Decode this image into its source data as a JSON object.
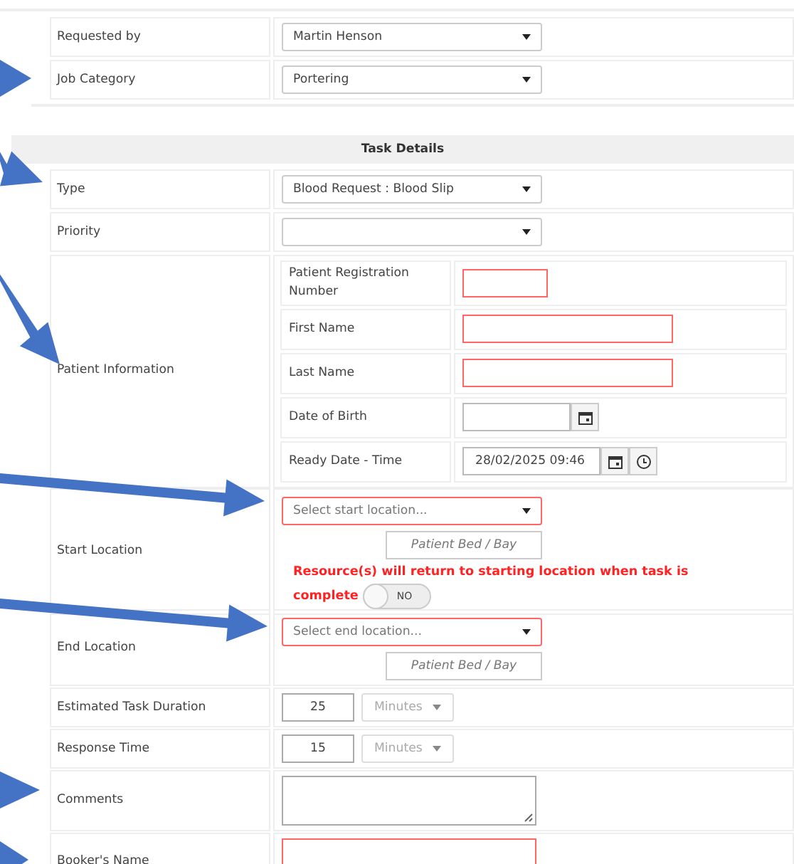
{
  "header_fields": [
    {
      "label": "Requested by",
      "kind": "select",
      "value": "Martin Henson",
      "required": false
    },
    {
      "label": "Job Category",
      "kind": "select",
      "value": "Portering",
      "required": false
    }
  ],
  "section_title": "Task Details",
  "task_fields": [
    {
      "label": "Type",
      "kind": "select",
      "value": "Blood Request : Blood Slip",
      "required": false
    },
    {
      "label": "Priority",
      "kind": "select",
      "required": false
    },
    {
      "label": "Patient Information",
      "kind": "patient",
      "subfields": [
        {
          "label": "Patient Registration Number",
          "kind": "short_text",
          "required": true
        },
        {
          "label": "First Name",
          "kind": "text",
          "required": true
        },
        {
          "label": "Last Name",
          "kind": "text",
          "required": true
        },
        {
          "label": "Date of Birth",
          "kind": "date",
          "required": false
        },
        {
          "label": "Ready Date - Time",
          "kind": "datetime",
          "value": "28/02/2025 09:46",
          "required": false
        }
      ]
    },
    {
      "label": "Start Location",
      "kind": "location",
      "placeholder": "Select start location...",
      "required": true,
      "bed_placeholder": "Patient Bed / Bay",
      "note_lines": [
        "Resource(s) will return to starting location when task is",
        "complete"
      ],
      "toggle": {
        "label": "NO",
        "on": false
      }
    },
    {
      "label": "End Location",
      "kind": "location",
      "placeholder": "Select end location...",
      "required": true,
      "bed_placeholder": "Patient Bed / Bay"
    },
    {
      "label": "Estimated Task Duration",
      "kind": "duration",
      "value": "25",
      "unit": "Minutes",
      "unit_disabled": true
    },
    {
      "label": "Response Time",
      "kind": "duration",
      "value": "15",
      "unit": "Minutes",
      "unit_disabled": true
    },
    {
      "label": "Comments",
      "kind": "textarea",
      "required": false
    },
    {
      "label": "Booker's Name",
      "kind": "text",
      "required": true
    }
  ]
}
